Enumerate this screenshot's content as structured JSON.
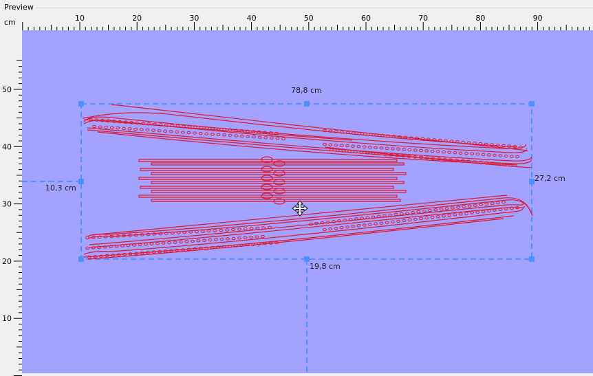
{
  "panel": {
    "title": "Preview",
    "unit_label": "cm"
  },
  "ruler": {
    "top_labels": [
      "10",
      "20",
      "30",
      "40",
      "50",
      "60",
      "70",
      "80",
      "90"
    ],
    "left_labels": [
      "50",
      "40",
      "30",
      "20",
      "10"
    ]
  },
  "selection": {
    "width_label": "78,8 cm",
    "height_label": "27,2 cm",
    "left_offset_label": "10,3 cm",
    "bottom_offset_label": "19,8 cm"
  },
  "colors": {
    "canvas_bg": "#a3a3ff",
    "stroke": "#e0182e",
    "guide": "#4f8fff"
  },
  "icons": {
    "cursor": "move-cursor-icon"
  }
}
